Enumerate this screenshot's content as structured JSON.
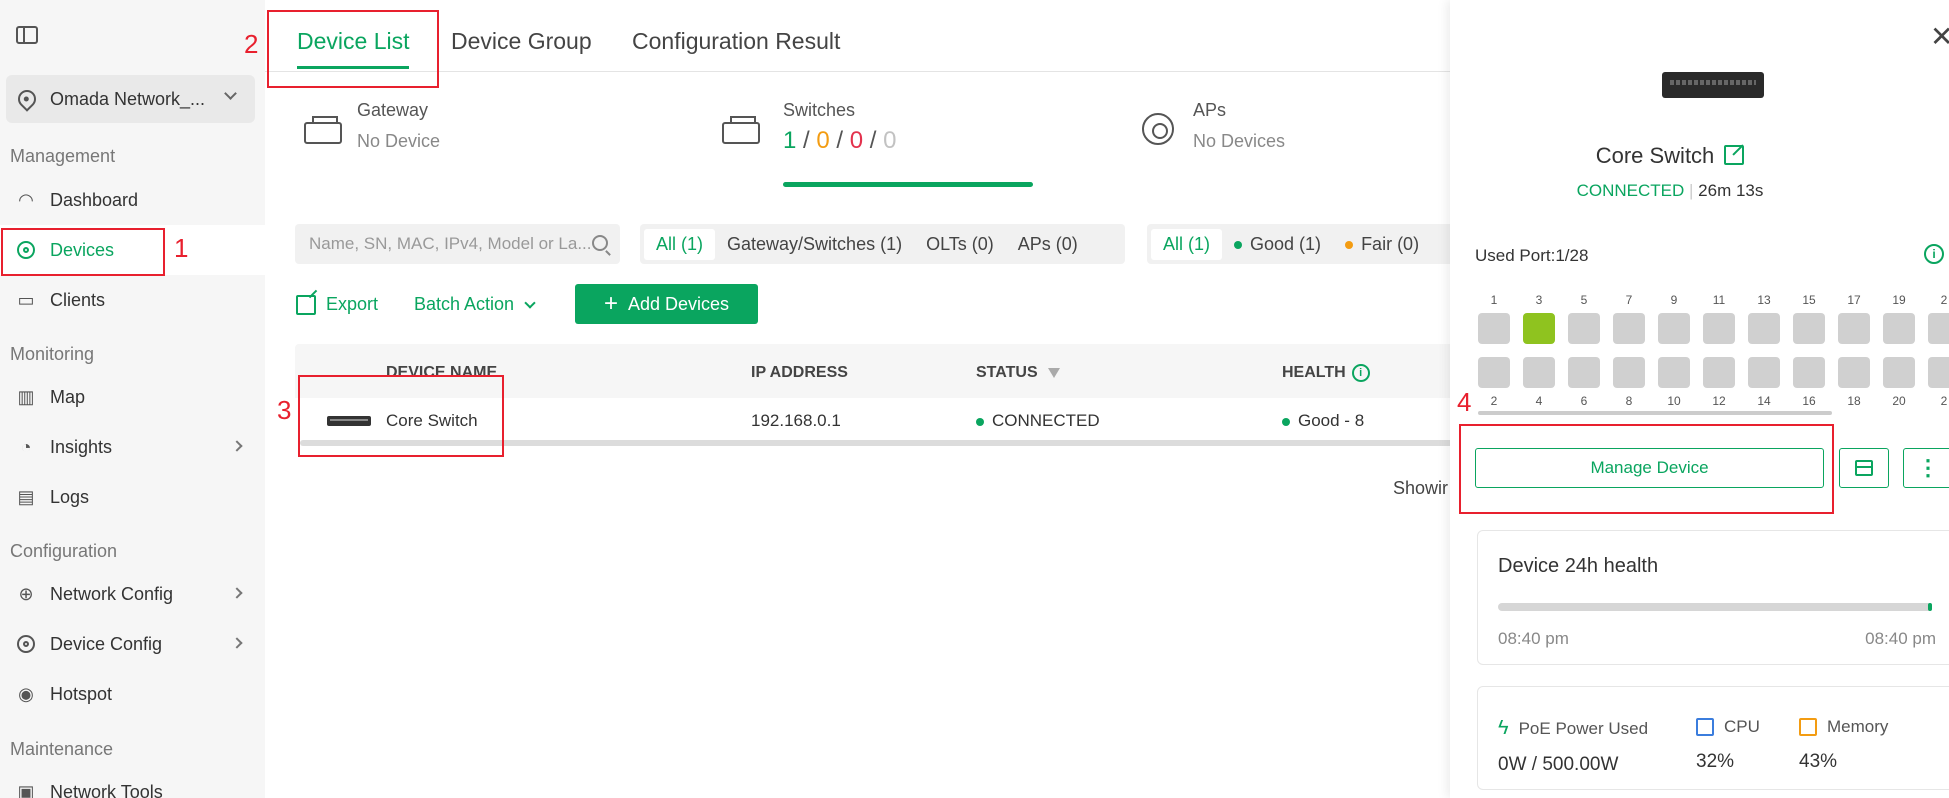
{
  "sidebar": {
    "site": "Omada Network_...",
    "sections": {
      "management": "Management",
      "monitoring": "Monitoring",
      "configuration": "Configuration",
      "maintenance": "Maintenance"
    },
    "items": {
      "dashboard": "Dashboard",
      "devices": "Devices",
      "clients": "Clients",
      "map": "Map",
      "insights": "Insights",
      "logs": "Logs",
      "network_config": "Network Config",
      "device_config": "Device Config",
      "hotspot": "Hotspot",
      "network_tools": "Network Tools"
    }
  },
  "tabs": [
    "Device List",
    "Device Group",
    "Configuration Result"
  ],
  "summary": {
    "gateway": {
      "title": "Gateway",
      "sub": "No Device"
    },
    "switches": {
      "title": "Switches",
      "c1": "1",
      "c2": "0",
      "c3": "0",
      "c4": "0",
      "sep": "/"
    },
    "aps": {
      "title": "APs",
      "sub": "No Devices"
    }
  },
  "search": {
    "placeholder": "Name, SN, MAC, IPv4, Model or La..."
  },
  "type_filter": [
    "All (1)",
    "Gateway/Switches (1)",
    "OLTs (0)",
    "APs (0)"
  ],
  "health_filter": [
    "All (1)",
    "Good (1)",
    "Fair (0)"
  ],
  "toolbar": {
    "export": "Export",
    "batch": "Batch Action",
    "add": "Add Devices"
  },
  "table": {
    "headers": [
      "DEVICE NAME",
      "IP ADDRESS",
      "STATUS",
      "HEALTH"
    ],
    "rows": [
      {
        "name": "Core Switch",
        "ip": "192.168.0.1",
        "status": "CONNECTED",
        "health": "Good - 8"
      }
    ],
    "showing": "Showir"
  },
  "panel": {
    "name": "Core Switch",
    "status": "CONNECTED",
    "uptime": "26m 13s",
    "used_port_label": "Used Port:",
    "used_port_value": "1/28",
    "ports_top": [
      "1",
      "3",
      "5",
      "7",
      "9",
      "11",
      "13",
      "15",
      "17",
      "19",
      "2"
    ],
    "ports_bottom": [
      "2",
      "4",
      "6",
      "8",
      "10",
      "12",
      "14",
      "16",
      "18",
      "20",
      "2"
    ],
    "used_ports": [
      3
    ],
    "manage": "Manage Device",
    "health_card": {
      "title": "Device 24h health",
      "start": "08:40 pm",
      "end": "08:40 pm"
    },
    "metrics": {
      "poe": {
        "label": "PoE Power Used",
        "value": "0W / 500.00W"
      },
      "cpu": {
        "label": "CPU",
        "value": "32%"
      },
      "memory": {
        "label": "Memory",
        "value": "43%"
      }
    }
  },
  "annotations": [
    "1",
    "2",
    "3",
    "4"
  ],
  "colors": {
    "accent": "#0aa55f",
    "annotation": "#e8202e",
    "port_used": "#8fc31f"
  }
}
